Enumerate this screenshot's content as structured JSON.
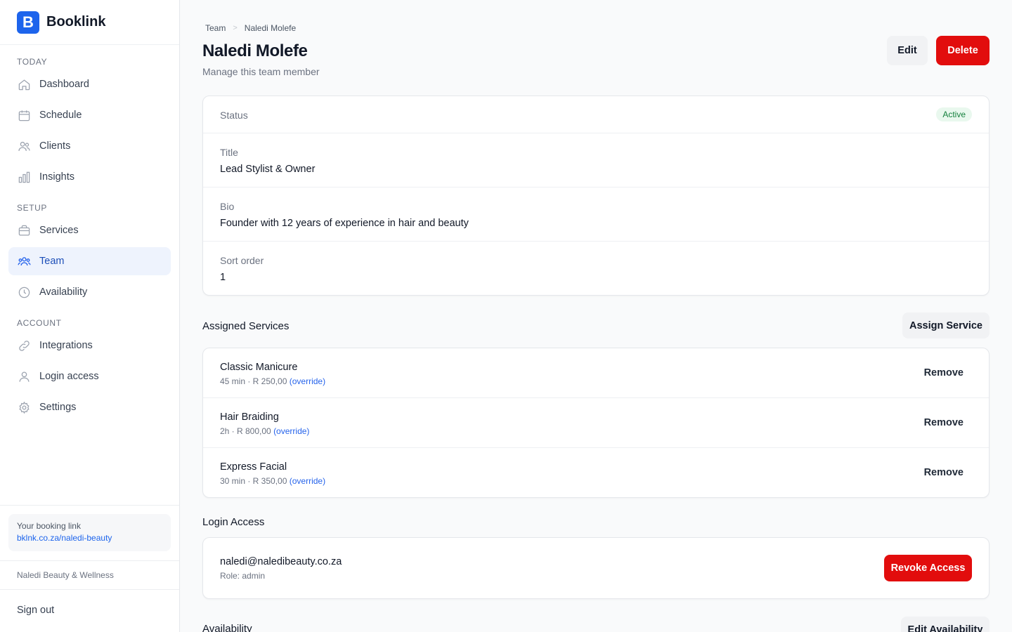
{
  "app": {
    "logo_letter": "B",
    "name": "Booklink"
  },
  "sidebar": {
    "sections": [
      {
        "label": "TODAY"
      },
      {
        "label": "SETUP"
      },
      {
        "label": "ACCOUNT"
      }
    ],
    "items": [
      {
        "label": "Dashboard",
        "icon": "home-icon"
      },
      {
        "label": "Schedule",
        "icon": "calendar-icon"
      },
      {
        "label": "Clients",
        "icon": "users-icon"
      },
      {
        "label": "Insights",
        "icon": "bar-chart-icon"
      },
      {
        "label": "Services",
        "icon": "briefcase-icon"
      },
      {
        "label": "Team",
        "icon": "team-icon",
        "active": true
      },
      {
        "label": "Availability",
        "icon": "clock-icon"
      },
      {
        "label": "Integrations",
        "icon": "link-icon"
      },
      {
        "label": "Login access",
        "icon": "user-icon"
      },
      {
        "label": "Settings",
        "icon": "gear-icon"
      }
    ],
    "booking_link_label": "Your booking link",
    "booking_link_url": "bklnk.co.za/naledi-beauty",
    "business_name": "Naledi Beauty & Wellness",
    "sign_out": "Sign out"
  },
  "breadcrumb": {
    "parent": "Team",
    "separator": ">",
    "current": "Naledi Molefe"
  },
  "header": {
    "title": "Naledi Molefe",
    "subtitle": "Manage this team member",
    "edit_label": "Edit",
    "delete_label": "Delete"
  },
  "details": {
    "status_label": "Status",
    "status_value": "Active",
    "title_label": "Title",
    "title_value": "Lead Stylist & Owner",
    "bio_label": "Bio",
    "bio_value": "Founder with 12 years of experience in hair and beauty",
    "sort_label": "Sort order",
    "sort_value": "1"
  },
  "assigned_services": {
    "title": "Assigned Services",
    "assign_label": "Assign Service",
    "remove_label": "Remove",
    "items": [
      {
        "name": "Classic Manicure",
        "meta": "45 min · R 250,00",
        "override": "(override)"
      },
      {
        "name": "Hair Braiding",
        "meta": "2h · R 800,00",
        "override": "(override)"
      },
      {
        "name": "Express Facial",
        "meta": "30 min · R 350,00",
        "override": "(override)"
      }
    ]
  },
  "login_access": {
    "title": "Login Access",
    "email": "naledi@naledibeauty.co.za",
    "role": "Role: admin",
    "revoke_label": "Revoke Access"
  },
  "availability": {
    "title": "Availability",
    "edit_label": "Edit Availability"
  },
  "colors": {
    "accent": "#1d64ec",
    "danger": "#e20d0d",
    "active_bg": "#eef3fd",
    "success": "#15803d"
  }
}
